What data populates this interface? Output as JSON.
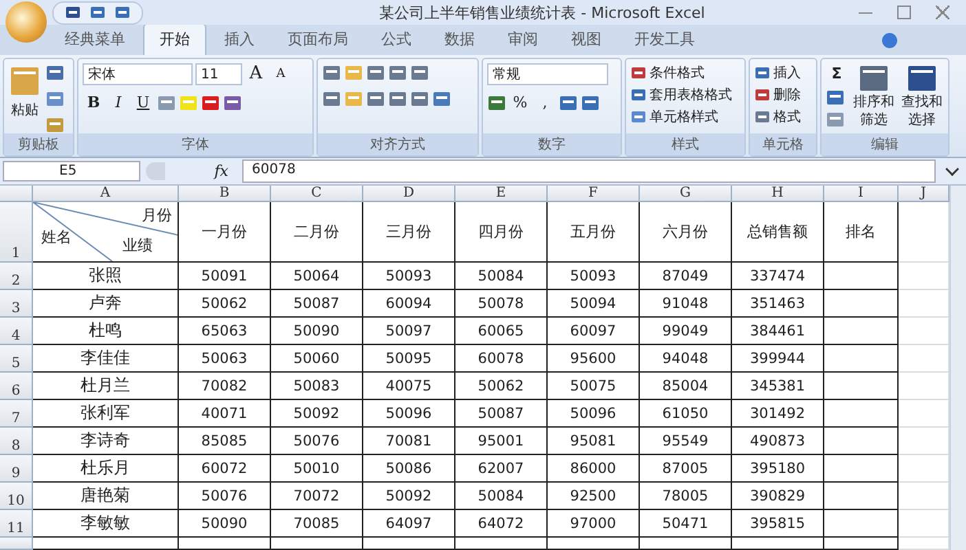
{
  "window": {
    "title": "某公司上半年销售业绩统计表 - Microsoft Excel"
  },
  "tabs": [
    {
      "label": "经典菜单",
      "selected": false
    },
    {
      "label": "开始",
      "selected": true
    },
    {
      "label": "插入",
      "selected": false
    },
    {
      "label": "页面布局",
      "selected": false
    },
    {
      "label": "公式",
      "selected": false
    },
    {
      "label": "数据",
      "selected": false
    },
    {
      "label": "审阅",
      "selected": false
    },
    {
      "label": "视图",
      "selected": false
    },
    {
      "label": "开发工具",
      "selected": false
    }
  ],
  "ribbon": {
    "clipboard": {
      "paste": "粘贴",
      "label": "剪贴板"
    },
    "font": {
      "font_name": "宋体",
      "font_size": "11",
      "grow": "A",
      "shrink": "A",
      "bold": "B",
      "italic": "I",
      "underline": "U",
      "label": "字体"
    },
    "alignment": {
      "label": "对齐方式"
    },
    "number": {
      "format": "常规",
      "percent": "%",
      "comma": ",",
      "label": "数字"
    },
    "styles": {
      "items": [
        "条件格式",
        "套用表格格式",
        "单元格样式"
      ],
      "label": "样式"
    },
    "cells": {
      "items": [
        "插入",
        "删除",
        "格式"
      ],
      "label": "单元格"
    },
    "editing": {
      "sum": "Σ",
      "sort": "排序和筛选",
      "find": "查找和选择",
      "label": "编辑"
    }
  },
  "formula_bar": {
    "name_box": "E5",
    "fx": "fx",
    "value": "60078"
  },
  "sheet": {
    "columns": [
      "A",
      "B",
      "C",
      "D",
      "E",
      "F",
      "G",
      "H",
      "I",
      "J"
    ],
    "header_row_number": "1",
    "corner": {
      "top": "月份",
      "middle": "业绩",
      "left": "姓名"
    },
    "headers": [
      "一月份",
      "二月份",
      "三月份",
      "四月份",
      "五月份",
      "六月份",
      "总销售额",
      "排名"
    ],
    "rows": [
      {
        "number": "2",
        "name": "张照",
        "values": [
          "50091",
          "50064",
          "50093",
          "50084",
          "50093",
          "87049",
          "337474"
        ]
      },
      {
        "number": "3",
        "name": "卢奔",
        "values": [
          "50062",
          "50087",
          "60094",
          "50078",
          "50094",
          "91048",
          "351463"
        ]
      },
      {
        "number": "4",
        "name": "杜鸣",
        "values": [
          "65063",
          "50090",
          "50097",
          "60065",
          "60097",
          "99049",
          "384461"
        ]
      },
      {
        "number": "5",
        "name": "李佳佳",
        "values": [
          "50063",
          "50060",
          "50095",
          "60078",
          "95600",
          "94048",
          "399944"
        ]
      },
      {
        "number": "6",
        "name": "杜月兰",
        "values": [
          "70082",
          "50083",
          "40075",
          "50062",
          "50075",
          "85004",
          "345381"
        ]
      },
      {
        "number": "7",
        "name": "张利军",
        "values": [
          "40071",
          "50092",
          "50096",
          "50087",
          "50096",
          "61050",
          "301492"
        ]
      },
      {
        "number": "8",
        "name": "李诗奇",
        "values": [
          "85085",
          "50076",
          "70081",
          "95001",
          "95081",
          "95549",
          "490873"
        ]
      },
      {
        "number": "9",
        "name": "杜乐月",
        "values": [
          "60072",
          "50010",
          "50086",
          "62007",
          "86000",
          "87005",
          "395180"
        ]
      },
      {
        "number": "10",
        "name": "唐艳菊",
        "values": [
          "50076",
          "70072",
          "50092",
          "50084",
          "92500",
          "78005",
          "390829"
        ]
      },
      {
        "number": "11",
        "name": "李敏敏",
        "values": [
          "50090",
          "70085",
          "64097",
          "64072",
          "97000",
          "50471",
          "395815"
        ]
      }
    ]
  }
}
